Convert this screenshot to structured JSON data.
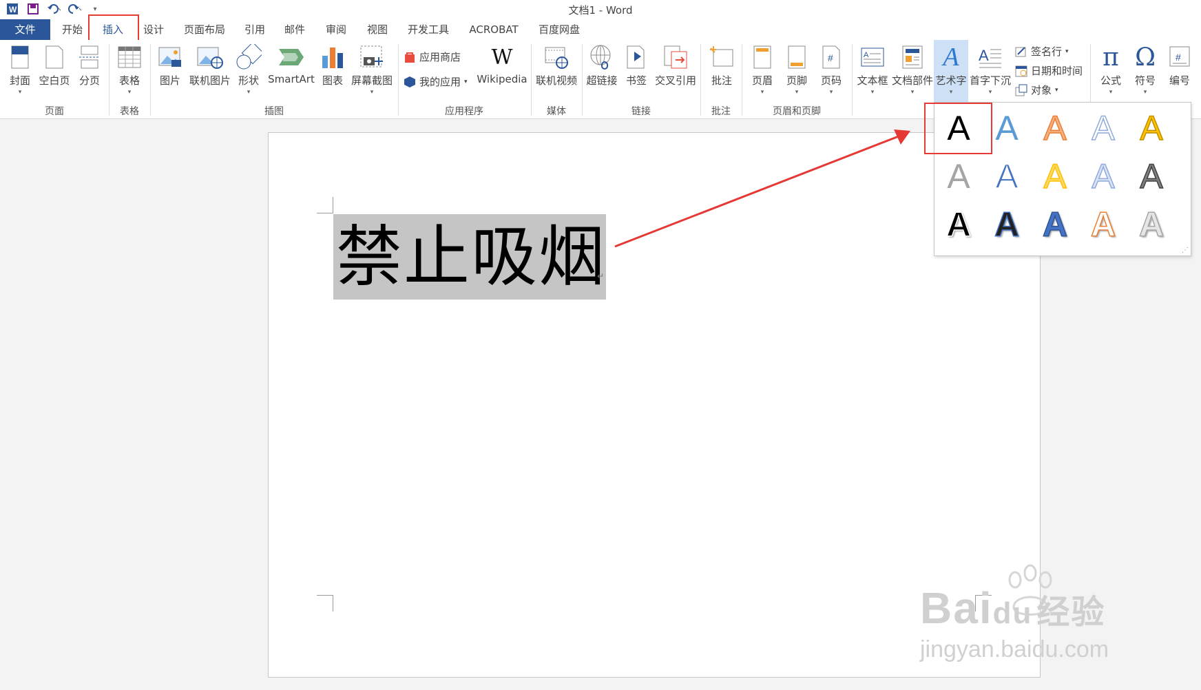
{
  "window": {
    "title": "文档1 - Word"
  },
  "qat": [
    "word-logo",
    "save-icon",
    "undo-icon",
    "redo-icon",
    "customize-icon"
  ],
  "tabs": {
    "file": "文件",
    "home": "开始",
    "insert": "插入",
    "design": "设计",
    "layout": "页面布局",
    "references": "引用",
    "mailings": "邮件",
    "review": "审阅",
    "view": "视图",
    "developer": "开发工具",
    "acrobat": "ACROBAT",
    "baidu": "百度网盘"
  },
  "ribbon": {
    "cover": "封面",
    "blank_page": "空白页",
    "page_break": "分页",
    "table": "表格",
    "picture": "图片",
    "online_picture": "联机图片",
    "shapes": "形状",
    "smartart": "SmartArt",
    "chart": "图表",
    "screenshot": "屏幕截图",
    "app_store": "应用商店",
    "my_apps": "我的应用",
    "wikipedia": "Wikipedia",
    "online_video": "联机视频",
    "hyperlink": "超链接",
    "bookmark": "书签",
    "cross_ref": "交叉引用",
    "comment": "批注",
    "header": "页眉",
    "footer": "页脚",
    "page_number": "页码",
    "textbox": "文本框",
    "quick_parts": "文档部件",
    "wordart": "艺术字",
    "dropcap": "首字下沉",
    "signature": "签名行",
    "datetime": "日期和时间",
    "object": "对象",
    "equation": "公式",
    "symbol": "符号",
    "number": "编号"
  },
  "groups": {
    "pages": "页面",
    "tables": "表格",
    "illustrations": "插图",
    "apps": "应用程序",
    "media": "媒体",
    "links": "链接",
    "comments": "批注",
    "header_footer": "页眉和页脚"
  },
  "document": {
    "selected_text": "禁止吸烟",
    "para_mark": "↵"
  },
  "gallery": {
    "glyph": "A",
    "styles": [
      {
        "fill": "#000000",
        "outline": "none"
      },
      {
        "fill": "#5b9bd5",
        "outline": "none"
      },
      {
        "fill": "#f4b183",
        "outline": "#ed7d31"
      },
      {
        "fill": "#ffffff",
        "outline": "#8faadc"
      },
      {
        "fill": "#ffc000",
        "outline": "#bf9000"
      },
      {
        "fill": "#a5a5a5",
        "outline": "none"
      },
      {
        "fill": "#4472c4",
        "outline": "#ffffff"
      },
      {
        "fill": "#ffd966",
        "outline": "#ffc000"
      },
      {
        "fill": "#dae3f3",
        "outline": "#8faadc"
      },
      {
        "fill": "#7f7f7f",
        "outline": "#404040"
      },
      {
        "fill": "#000000",
        "outline": "#ffffff"
      },
      {
        "fill": "#222222",
        "outline": "#4472c4"
      },
      {
        "fill": "#4472c4",
        "outline": "#2f5597"
      },
      {
        "fill": "#ffffff",
        "outline": "#ed7d31"
      },
      {
        "fill": "#e7e6e6",
        "outline": "#a5a5a5"
      }
    ]
  },
  "colors": {
    "accent": "#2b579a",
    "highlight": "#e53935",
    "selection": "#c5c5c5"
  },
  "watermark": {
    "brand": "Bai",
    "brand2": "du",
    "suffix": "经验",
    "url": "jingyan.baidu.com"
  }
}
